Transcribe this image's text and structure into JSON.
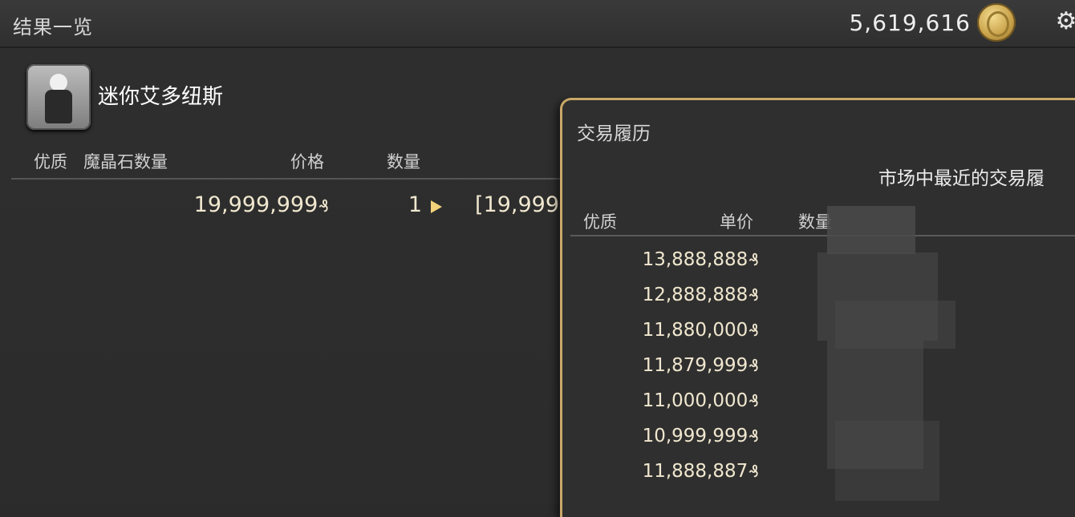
{
  "window": {
    "title": "结果一览",
    "gil_amount": "5,619,616"
  },
  "item": {
    "name": "迷你艾多纽斯"
  },
  "listing_headers": {
    "quality": "优质",
    "materia": "魔晶石数量",
    "price": "价格",
    "quantity": "数量"
  },
  "listing_row": {
    "price": "19,999,999",
    "quantity": "1",
    "seller_partial": "[19,999"
  },
  "currency_symbol": "₰",
  "history": {
    "title": "交易履历",
    "description": "市场中最近的交易履",
    "headers": {
      "quality": "优质",
      "unit_price": "单价",
      "quantity": "数量"
    },
    "prices": [
      "13,888,888",
      "12,888,888",
      "11,880,000",
      "11,879,999",
      "11,000,000",
      "10,999,999",
      "11,888,887"
    ]
  },
  "colors": {
    "accent_gold": "#c9a867",
    "price_text": "#f0e7cf"
  }
}
